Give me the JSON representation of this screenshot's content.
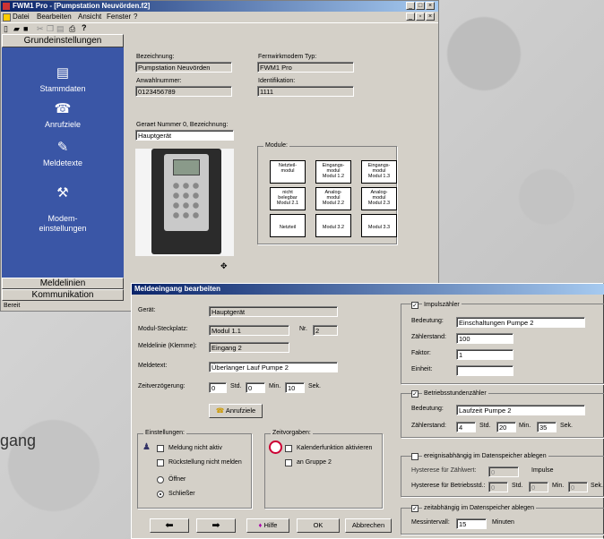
{
  "background": {
    "word": "gang"
  },
  "main_window": {
    "title": "FWM1 Pro - [Pumpstation Neuvörden.f2]",
    "menu": [
      "Datei",
      "Bearbeiten",
      "Ansicht",
      "Fenster",
      "?"
    ],
    "sidebar": {
      "header": "Grundeinstellungen",
      "items": [
        {
          "label": "Stammdaten",
          "icon": "clipboard-icon"
        },
        {
          "label": "Anrufziele",
          "icon": "phone-icon"
        },
        {
          "label": "Meldetexte",
          "icon": "notes-icon"
        },
        {
          "label": "Modem-\neinstellungen",
          "icon": "modem-tools-icon"
        }
      ],
      "footer_items": [
        "Meldelinien",
        "Kommunikation"
      ]
    },
    "status": "Bereit",
    "form": {
      "bezeichnung_label": "Bezeichnung:",
      "bezeichnung_value": "Pumpstation Neuvörden",
      "modem_typ_label": "Fernwirkmodem Typ:",
      "modem_typ_value": "FWM1 Pro",
      "anwahl_label": "Anwahlnummer:",
      "anwahl_value": "0123456789",
      "ident_label": "Identifikation:",
      "ident_value": "1111",
      "geraet_label": "Geraet Nummer 0, Bezeichnung:",
      "geraet_value": "Hauptgerät",
      "module_label": "Module:",
      "modules": [
        "Netzteil-\nmodul",
        "Eingangs-\nmodul\nModul 1.2",
        "Eingangs-\nmodul\nModul 1.3",
        "nicht\nbelegbar\nModul 2.1",
        "Analog-\nmodul\nModul 2.2",
        "Analog-\nmodul\nModul 2.3",
        "Netzteil",
        "Modul 3.2",
        "Modul 3.3"
      ]
    }
  },
  "dialog": {
    "title": "Meldeeingang bearbeiten",
    "geraet_label": "Gerät:",
    "geraet_value": "Hauptgerät",
    "steckplatz_label": "Modul-Steckplatz:",
    "steckplatz_value": "Modul 1.1",
    "nr_label": "Nr.",
    "nr_value": "2",
    "meldelinie_label": "Meldelinie (Klemme):",
    "meldelinie_value": "Eingang 2",
    "meldetext_label": "Meldetext:",
    "meldetext_value": "Überlanger Lauf Pumpe 2",
    "zeitverz_label": "Zeitverzögerung:",
    "zeitverz": {
      "h": "0",
      "h_unit": "Std.",
      "m": "0",
      "m_unit": "Min.",
      "s": "10",
      "s_unit": "Sek."
    },
    "anrufziele_button": "Anrufziele",
    "einstellungen_label": "Einstellungen:",
    "einstellungen": [
      "Meldung nicht aktiv",
      "Rückstellung nicht melden"
    ],
    "oeffner_label": "Öffner",
    "schliesser_label": "Schließer",
    "zeitvorgaben_label": "Zeitvorgaben:",
    "kalender_label": "Kalenderfunktion aktivieren",
    "gruppe_label": "an Gruppe 2",
    "impuls": {
      "label": "Impulszähler",
      "bedeutung_label": "Bedeutung:",
      "bedeutung_value": "Einschaltungen Pumpe 2",
      "zaehlerstand_label": "Zählerstand:",
      "zaehlerstand_value": "100",
      "faktor_label": "Faktor:",
      "faktor_value": "1",
      "einheit_label": "Einheit:",
      "einheit_value": ""
    },
    "betrieb": {
      "label": "Betriebsstundenzähler",
      "bedeutung_label": "Bedeutung:",
      "bedeutung_value": "Laufzeit Pumpe 2",
      "zaehlerstand_label": "Zählerstand:",
      "h": "4",
      "h_unit": "Std.",
      "m": "20",
      "m_unit": "Min.",
      "s": "35",
      "s_unit": "Sek."
    },
    "ereignis": {
      "label": "ereignisabhängig im Datenspeicher ablegen",
      "hyst_zaehl_label": "Hysterese für Zählwert:",
      "hyst_zaehl_value": "0",
      "impulse_label": "Impulse",
      "hyst_betrieb_label": "Hysterese für Betriebsstd.:",
      "h": "0",
      "h_unit": "Std.",
      "m": "0",
      "m_unit": "Min.",
      "s": "0",
      "s_unit": "Sek."
    },
    "zeitabh": {
      "label": "zeitabhängig im Datenspeicher ablegen",
      "messintervall_label": "Messintervall:",
      "messintervall_value": "15",
      "minuten_label": "Minuten"
    },
    "buttons": {
      "hilfe": "Hilfe",
      "ok": "OK",
      "abbrechen": "Abbrechen"
    }
  }
}
